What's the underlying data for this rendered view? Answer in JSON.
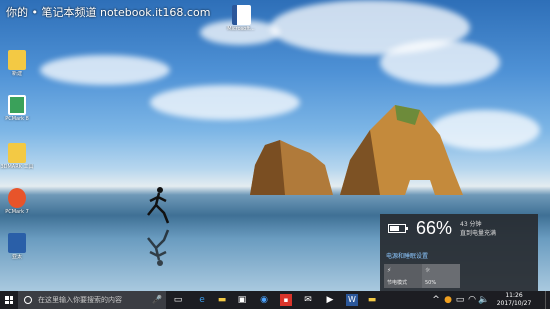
{
  "watermark": "你的 • 笔记本频道 notebook.it168.com",
  "desktop_icons": [
    {
      "label": "Microsoft...",
      "icon": "word-document-icon"
    },
    {
      "label": "新建",
      "icon": "folder-icon"
    },
    {
      "label": "PCMark 8",
      "icon": "pcmark-icon"
    },
    {
      "label": "3DMARK 工具",
      "icon": "folder-icon"
    },
    {
      "label": "PCMark 7",
      "icon": "pcmark7-icon"
    },
    {
      "label": "亚太",
      "icon": "app-icon"
    }
  ],
  "battery_flyout": {
    "percent_text": "66%",
    "percent_value": 66,
    "time_remaining": "43 分钟",
    "status": "直到电量充满",
    "settings_link": "电源和睡眠设置",
    "tiles": [
      {
        "label": "节电模式",
        "icon": "battery-saver-icon"
      },
      {
        "label": "50%",
        "icon": "brightness-icon"
      }
    ]
  },
  "taskbar": {
    "search_placeholder": "在这里输入你要搜索的内容",
    "apps": [
      "task-view-icon",
      "edge-icon",
      "explorer-icon",
      "store-icon",
      "chrome-icon",
      "app-red-icon",
      "mail-icon",
      "game-icon",
      "word-icon",
      "explorer2-icon"
    ],
    "clock_time": "11:26",
    "clock_date": "2017/10/27"
  },
  "colors": {
    "taskbar": "#1c1d22",
    "flyout_bg": "#282c32",
    "link": "#8cc7ff"
  }
}
